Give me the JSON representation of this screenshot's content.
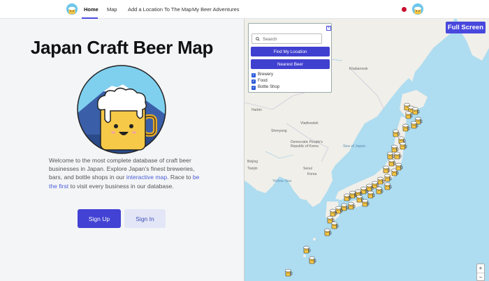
{
  "nav": {
    "items": [
      "Home",
      "Map",
      "Add a Location To The Map",
      "My Beer Adventures"
    ],
    "active": "Home"
  },
  "hero": {
    "title": "Japan Craft Beer Map",
    "desc_part1": "Welcome to the most complete database of craft beer businesses in Japan. Explore Japan's finest breweries, bars, and bottle shops in our ",
    "link1": "interactive map",
    "desc_part2": ". Race to ",
    "link2": "be the first",
    "desc_part3": " to visit every business in our database.",
    "signup": "Sign Up",
    "signin": "Sign In"
  },
  "map": {
    "search_placeholder": "Search",
    "find_location": "Find My Location",
    "nearest_beer": "Nearest Beer",
    "filters": [
      "Brewery",
      "Food",
      "Bottle Shop"
    ],
    "full_screen": "Full Screen",
    "zoom_in": "+",
    "zoom_out": "−",
    "labels": {
      "sea_of_japan": "Sea of Japan",
      "yellow_sea": "Yellow Sea",
      "khabarovsk": "Khabarovsk",
      "vladivostok": "Vladivostok",
      "dprk": "Democratic People's Republic of Korea",
      "korea": "Korea",
      "seoul": "Seoul",
      "shenyang": "Shenyang",
      "harbin": "Harbin",
      "beijing": "Beijing",
      "tianjin": "Tianjin",
      "yellow_sea_2": "Yellow"
    },
    "colors": {
      "sea": "#aedcf0",
      "land": "#f0efe9",
      "accent": "#4848de"
    }
  }
}
